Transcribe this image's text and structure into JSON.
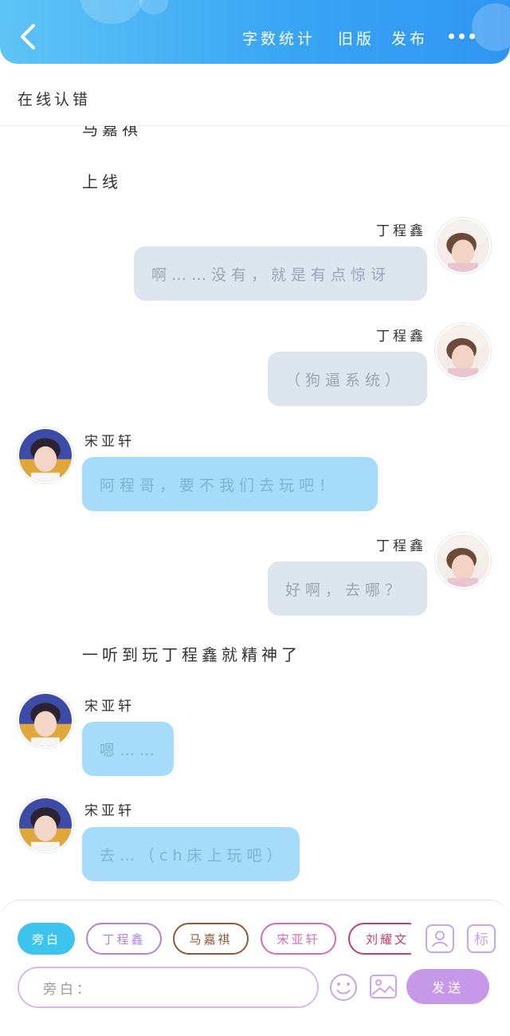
{
  "header": {
    "back_icon": "chevron-left-icon",
    "word_count_label": "字数统计",
    "old_version_label": "旧版",
    "publish_label": "发布",
    "more_icon": "more-dots-icon",
    "colors": {
      "gradient_start": "#5fc4f5",
      "gradient_end": "#2f95f2"
    }
  },
  "subheader": {
    "title": "在线认错"
  },
  "chat": {
    "messages": [
      {
        "kind": "narration",
        "text": "马嘉祺"
      },
      {
        "kind": "narration",
        "text": "上线"
      },
      {
        "kind": "message",
        "side": "right",
        "speaker": "丁程鑫",
        "text": "啊……没有，就是有点惊讶"
      },
      {
        "kind": "message",
        "side": "right",
        "speaker": "丁程鑫",
        "text": "（狗逼系统）"
      },
      {
        "kind": "message",
        "side": "left",
        "speaker": "宋亚轩",
        "text": "阿程哥，要不我们去玩吧！"
      },
      {
        "kind": "message",
        "side": "right",
        "speaker": "丁程鑫",
        "text": "好啊，去哪？"
      },
      {
        "kind": "narration",
        "text": "一听到玩丁程鑫就精神了"
      },
      {
        "kind": "message",
        "side": "left",
        "speaker": "宋亚轩",
        "text": "嗯……"
      },
      {
        "kind": "message",
        "side": "left",
        "speaker": "宋亚轩",
        "text": "去…（ch床上玩吧）"
      }
    ],
    "colors": {
      "right_bubble": "#dde5ef",
      "left_bubble": "#a6dcfa"
    }
  },
  "composer": {
    "roles": [
      {
        "label": "旁白",
        "active": true,
        "color": "#3dc4ee"
      },
      {
        "label": "丁程鑫",
        "active": false,
        "color": "#b183de"
      },
      {
        "label": "马嘉祺",
        "active": false,
        "color": "#8a5a3a"
      },
      {
        "label": "宋亚轩",
        "active": false,
        "color": "#d26db8"
      },
      {
        "label": "刘耀文",
        "active": false,
        "color": "#c0406a"
      }
    ],
    "character_icon": "character-card-icon",
    "tag_label": "标",
    "input_placeholder": "旁白：",
    "emoji_icon": "smiley-icon",
    "image_icon": "image-icon",
    "send_label": "发送",
    "colors": {
      "accent": "#c798ea"
    }
  }
}
